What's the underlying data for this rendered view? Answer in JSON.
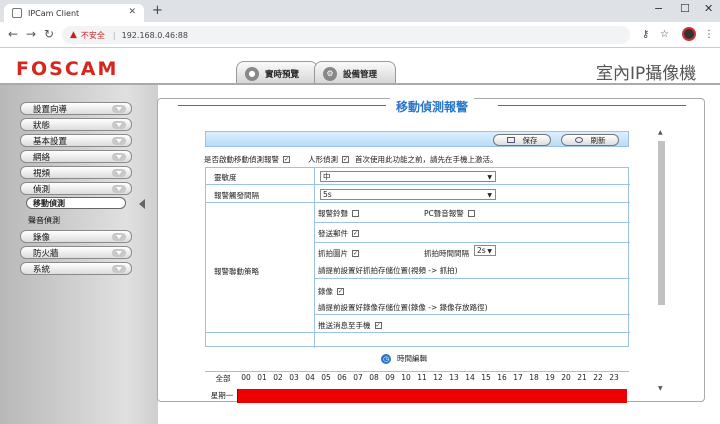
{
  "browser": {
    "tab_title": "IPCam Client",
    "not_secure": "不安全",
    "url": "192.168.0.46:88"
  },
  "header": {
    "logo": "FOSCAM",
    "tab_live": "實時預覽",
    "tab_settings": "設備管理",
    "camera_type": "室內IP攝像機"
  },
  "sidebar": {
    "items": [
      "設置向導",
      "狀態",
      "基本設置",
      "網絡",
      "視頻",
      "偵測"
    ],
    "sub_selected": "移動偵測",
    "sub_other": "聲音偵測",
    "items_after": [
      "錄像",
      "防火牆",
      "系統"
    ]
  },
  "panel": {
    "title": "移動偵測報警",
    "save": "保存",
    "refresh": "刷新",
    "enable_label": "是否啟動移動偵測報警",
    "human_label": "人形偵測",
    "human_note": "首次使用此功能之前，請先在手機上激活。",
    "sensitivity_label": "靈敏度",
    "sensitivity_value": "中",
    "interval_label": "報警觸發間隔",
    "interval_value": "5s",
    "action_label": "報警聯動策略",
    "alarm_sound": "報警鈴聲",
    "pc_sound": "PC聲音報警",
    "send_email": "發送郵件",
    "snapshot": "抓拍圖片",
    "snap_interval_label": "抓拍時間間隔",
    "snap_interval_value": "2s",
    "snap_note": "請提前設置好抓拍存儲位置(視頻 -> 抓拍)",
    "record": "錄像",
    "record_note": "請提前設置好錄像存儲位置(錄像 -> 錄像存放路徑)",
    "push": "推送消息至手機",
    "schedule_title": "時間編輯",
    "all_label": "全部",
    "day_label": "星期一",
    "hours": [
      "00",
      "01",
      "02",
      "03",
      "04",
      "05",
      "06",
      "07",
      "08",
      "09",
      "10",
      "11",
      "12",
      "13",
      "14",
      "15",
      "16",
      "17",
      "18",
      "19",
      "20",
      "21",
      "22",
      "23"
    ]
  }
}
